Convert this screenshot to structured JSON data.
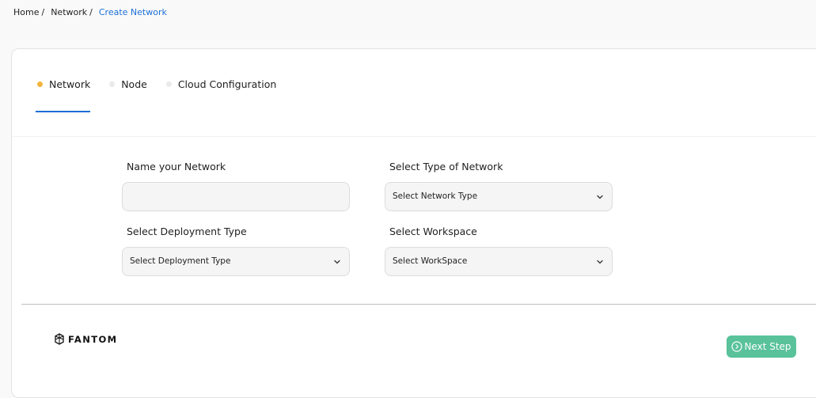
{
  "breadcrumb": {
    "items": [
      "Home",
      "Network"
    ],
    "separator": "/",
    "current": "Create Network"
  },
  "tabs": [
    {
      "label": "Network",
      "active": true
    },
    {
      "label": "Node",
      "active": false
    },
    {
      "label": "Cloud Configuration",
      "active": false
    }
  ],
  "form": {
    "name_label": "Name your Network",
    "name_value": "",
    "network_type_label": "Select Type of Network",
    "network_type_value": "Select Network Type",
    "deployment_label": "Select Deployment Type",
    "deployment_value": "Select Deployment Type",
    "workspace_label": "Select Workspace",
    "workspace_value": "Select WorkSpace"
  },
  "footer": {
    "logo_text": "FANTOM",
    "next_button": "Next Step"
  },
  "colors": {
    "accent_blue": "#1d6fd6",
    "active_dot": "#f5b53c",
    "button_green": "#59c29a"
  }
}
